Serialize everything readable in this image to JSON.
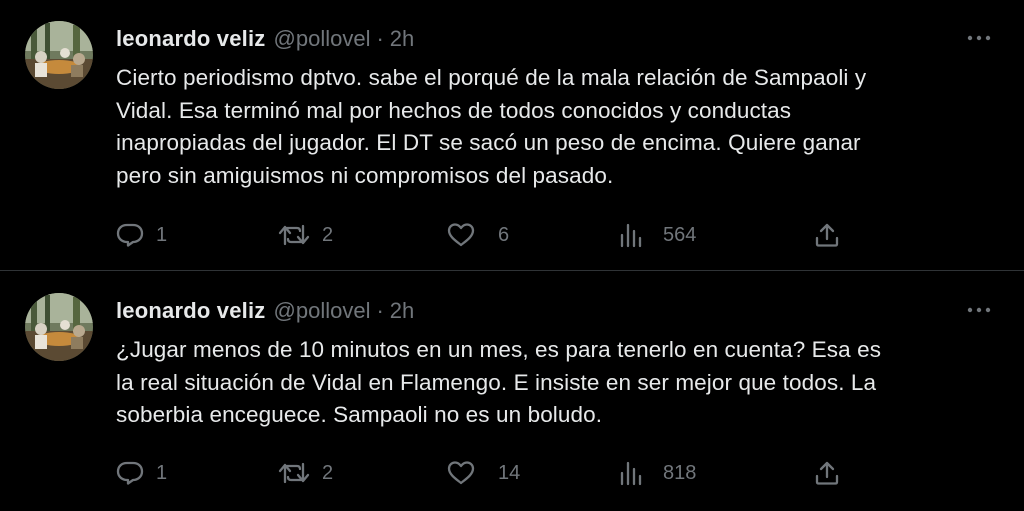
{
  "tweets": [
    {
      "author": {
        "name": "leonardo veliz",
        "handle": "@pollovel",
        "separator": "·",
        "time": "2h",
        "avatar": "profile-photo"
      },
      "text": "Cierto periodismo dptvo. sabe el porqué de la mala relación de Sampaoli y\nVidal. Esa terminó mal por hechos de todos conocidos y conductas\ninapropiadas del jugador. El DT se sacó un peso de encima. Quiere ganar\npero sin amiguismos ni compromisos del pasado.",
      "stats": {
        "replies": "1",
        "retweets": "2",
        "likes": "6",
        "views": "564"
      },
      "icons": {
        "more": "more-icon",
        "reply": "reply-icon",
        "retweet": "retweet-icon",
        "like": "heart-icon",
        "views": "views-icon",
        "share": "share-icon"
      }
    },
    {
      "author": {
        "name": "leonardo veliz",
        "handle": "@pollovel",
        "separator": "·",
        "time": "2h",
        "avatar": "profile-photo"
      },
      "text": "¿Jugar menos de 10 minutos en un mes, es para tenerlo en cuenta? Esa es\nla real situación de Vidal en Flamengo. E insiste en ser mejor que todos. La\nsoberbia enceguece. Sampaoli no es un boludo.",
      "stats": {
        "replies": "1",
        "retweets": "2",
        "likes": "14",
        "views": "818"
      },
      "icons": {
        "more": "more-icon",
        "reply": "reply-icon",
        "retweet": "retweet-icon",
        "like": "heart-icon",
        "views": "views-icon",
        "share": "share-icon"
      }
    }
  ],
  "colors": {
    "background": "#000000",
    "primary_text": "#e7e9ea",
    "secondary_text": "#71767b",
    "divider": "#2f3336"
  }
}
